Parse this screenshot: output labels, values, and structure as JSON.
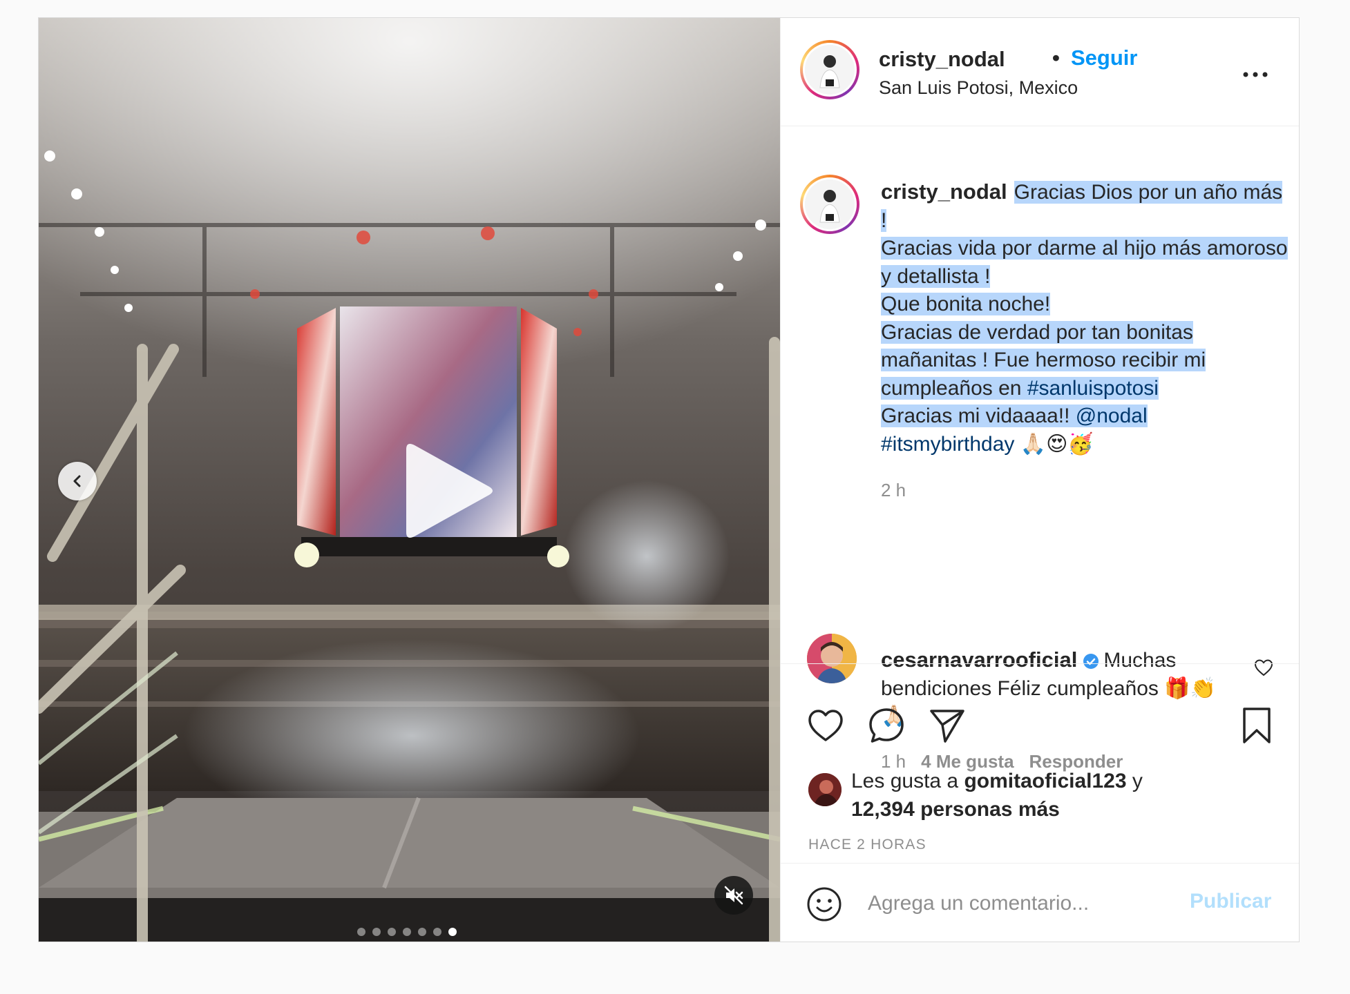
{
  "post": {
    "author": {
      "username": "cristy_nodal",
      "follow_label": "Seguir",
      "bullet": "•",
      "location": "San Luis Potosi, Mexico"
    },
    "media": {
      "type": "video",
      "carousel_total": 7,
      "carousel_active": 7
    },
    "caption": {
      "username": "cristy_nodal",
      "lines": [
        "Gracias Dios por un año más !",
        "Gracias vida por darme al hijo más amoroso y detallista !",
        "Que bonita noche!",
        "Gracias de verdad por tan bonitas mañanitas ! Fue hermoso recibir mi cumpleaños en"
      ],
      "hashtag_location": "#sanluispotosi",
      "line_thanks": "Gracias mi vidaaaa!!",
      "mention": "@nodal",
      "hashtag_birthday": "#itsmybirthday",
      "emojis": "🙏🏻😍🥳",
      "time": "2 h"
    },
    "comment": {
      "username": "cesarnavarrooficial",
      "verified": true,
      "text": "Muchas bendiciones Féliz cumpleaños",
      "emojis": "🎁👏🙏🏻",
      "time": "1 h",
      "likes": "4 Me gusta",
      "reply_label": "Responder"
    },
    "likes": {
      "prefix": "Les gusta a",
      "user": "gomitaoficial123",
      "connector": "y",
      "count_text": "12,394 personas más"
    },
    "date_label": "HACE 2 HORAS",
    "add_comment": {
      "placeholder": "Agrega un comentario...",
      "publish_label": "Publicar"
    }
  },
  "colors": {
    "link_blue": "#0095f6",
    "hashtag": "#00376b",
    "highlight": "#b7d6fb",
    "publish_disabled": "#b2dffc",
    "meta_gray": "#8e8e8e"
  }
}
